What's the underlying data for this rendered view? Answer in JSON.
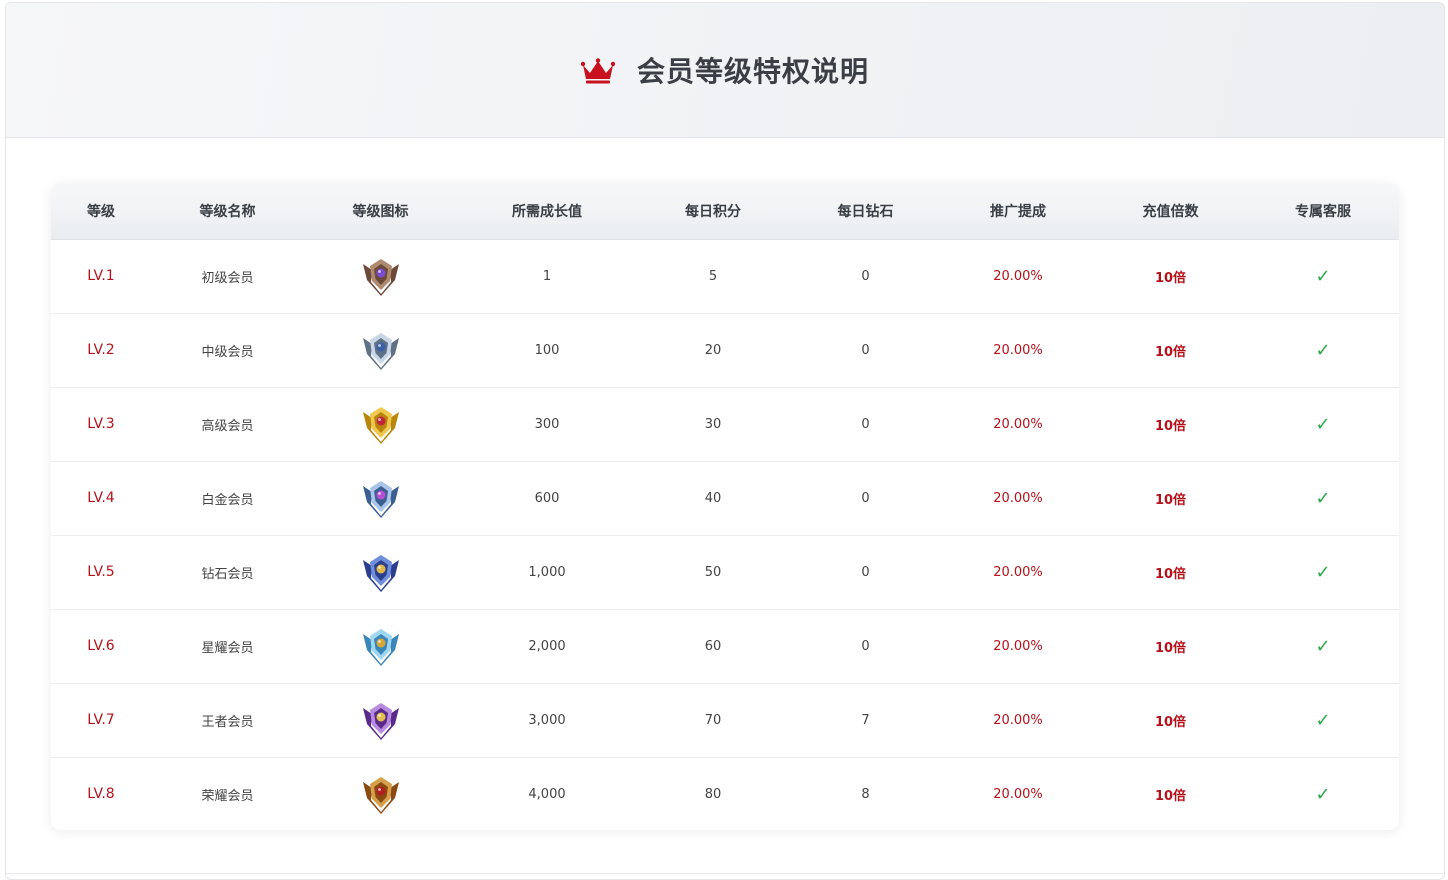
{
  "header": {
    "title": "会员等级特权说明",
    "icon": "crown-icon"
  },
  "table": {
    "columns": [
      "等级",
      "等级名称",
      "等级图标",
      "所需成长值",
      "每日积分",
      "每日钻石",
      "推广提成",
      "充值倍数",
      "专属客服"
    ],
    "rows": [
      {
        "level": "LV.1",
        "name": "初级会员",
        "badge": "bronze-badge-icon",
        "growth": "1",
        "points": "5",
        "diamonds": "0",
        "commission": "20.00%",
        "multiplier": "10倍",
        "service": "✓"
      },
      {
        "level": "LV.2",
        "name": "中级会员",
        "badge": "silver-badge-icon",
        "growth": "100",
        "points": "20",
        "diamonds": "0",
        "commission": "20.00%",
        "multiplier": "10倍",
        "service": "✓"
      },
      {
        "level": "LV.3",
        "name": "高级会员",
        "badge": "gold-badge-icon",
        "growth": "300",
        "points": "30",
        "diamonds": "0",
        "commission": "20.00%",
        "multiplier": "10倍",
        "service": "✓"
      },
      {
        "level": "LV.4",
        "name": "白金会员",
        "badge": "platinum-badge-icon",
        "growth": "600",
        "points": "40",
        "diamonds": "0",
        "commission": "20.00%",
        "multiplier": "10倍",
        "service": "✓"
      },
      {
        "level": "LV.5",
        "name": "钻石会员",
        "badge": "diamond-badge-icon",
        "growth": "1,000",
        "points": "50",
        "diamonds": "0",
        "commission": "20.00%",
        "multiplier": "10倍",
        "service": "✓"
      },
      {
        "level": "LV.6",
        "name": "星耀会员",
        "badge": "star-badge-icon",
        "growth": "2,000",
        "points": "60",
        "diamonds": "0",
        "commission": "20.00%",
        "multiplier": "10倍",
        "service": "✓"
      },
      {
        "level": "LV.7",
        "name": "王者会员",
        "badge": "king-badge-icon",
        "growth": "3,000",
        "points": "70",
        "diamonds": "7",
        "commission": "20.00%",
        "multiplier": "10倍",
        "service": "✓"
      },
      {
        "level": "LV.8",
        "name": "荣耀会员",
        "badge": "glory-badge-icon",
        "growth": "4,000",
        "points": "80",
        "diamonds": "8",
        "commission": "20.00%",
        "multiplier": "10倍",
        "service": "✓"
      }
    ]
  },
  "colors": {
    "accent_red": "#b5121b",
    "check_green": "#2aa84a",
    "badge_palettes": [
      [
        "#6b4a3a",
        "#b08a6e",
        "#7b4bd1"
      ],
      [
        "#5f7186",
        "#c8d6e6",
        "#3a5fa8"
      ],
      [
        "#b8860b",
        "#f0c850",
        "#c0283a"
      ],
      [
        "#3c5f92",
        "#a9c6ea",
        "#b64fd6"
      ],
      [
        "#2c3f8f",
        "#6f8fd8",
        "#e0b84a"
      ],
      [
        "#3a86b8",
        "#9fd6f2",
        "#d9a636"
      ],
      [
        "#5a2a8a",
        "#b68ae0",
        "#e2c050"
      ],
      [
        "#8a4a12",
        "#d6a04a",
        "#b02020"
      ]
    ]
  }
}
